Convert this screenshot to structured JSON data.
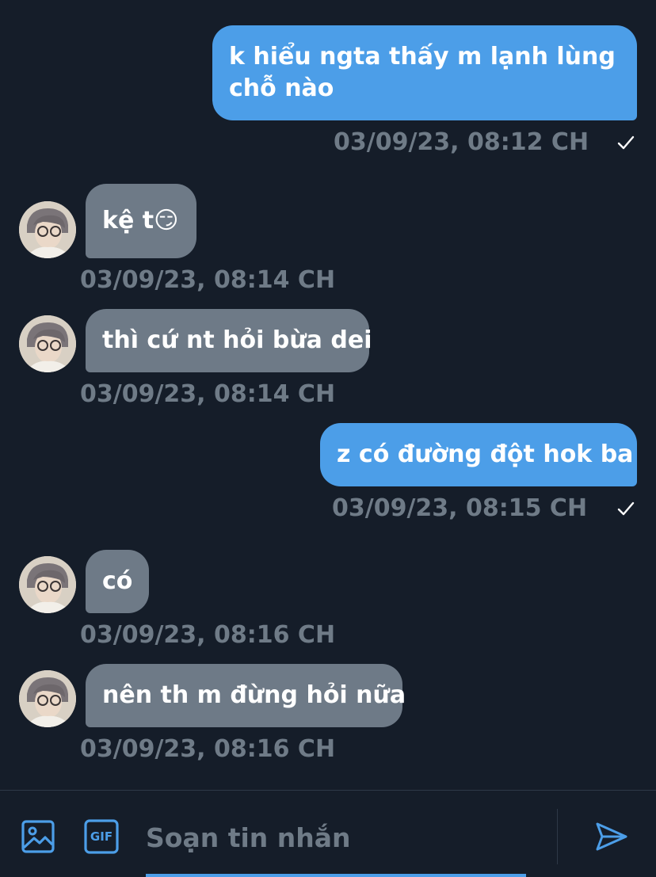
{
  "messages": [
    {
      "direction": "out",
      "text": "k hiểu ngta thấy m lạnh lùng chỗ nào",
      "timestamp": "03/09/23, 08:12 CH",
      "read_receipt": "check-icon"
    },
    {
      "direction": "in",
      "text": "kệ t😏",
      "timestamp": "03/09/23, 08:14 CH"
    },
    {
      "direction": "in",
      "text": "thì cứ nt hỏi bừa dei",
      "timestamp": "03/09/23, 08:14 CH"
    },
    {
      "direction": "out",
      "text": "z có đường đột hok ba",
      "timestamp": "03/09/23, 08:15 CH",
      "read_receipt": "check-icon"
    },
    {
      "direction": "in",
      "text": "có",
      "timestamp": "03/09/23, 08:16 CH"
    },
    {
      "direction": "in",
      "text": "nên th m đừng hỏi nữa",
      "timestamp": "03/09/23, 08:16 CH"
    }
  ],
  "composer": {
    "placeholder": "Soạn tin nhắn",
    "media_icon": "image-icon",
    "gif_label": "GIF",
    "send_icon": "send-icon"
  },
  "colors": {
    "background": "#151d29",
    "outgoing_bubble": "#4c9ee8",
    "incoming_bubble": "#6e7a87",
    "timestamp": "#6f7b87",
    "accent": "#4c9ee8"
  }
}
